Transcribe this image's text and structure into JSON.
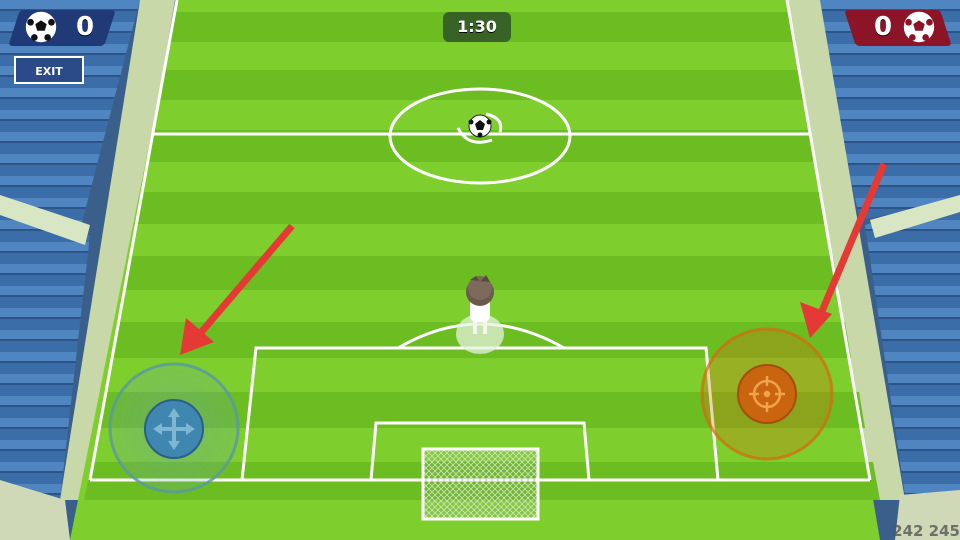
{
  "hud": {
    "score_left": "0",
    "score_right": "0",
    "timer": "1:30",
    "exit_label": "EXIT",
    "fps_readout": "242 245"
  },
  "colors": {
    "pitch_light": "#7ecf2e",
    "pitch_dark": "#6cbd22",
    "team_left": "#203a78",
    "team_right": "#8b1426",
    "move_joystick": "#3f86b0",
    "action_button": "#d56a0e",
    "arrow": "#e53935"
  },
  "icons": {
    "move_joystick": "four-way-arrows-icon",
    "action_button": "crosshair-icon",
    "score_left": "soccer-ball-icon",
    "score_right": "soccer-ball-icon"
  }
}
